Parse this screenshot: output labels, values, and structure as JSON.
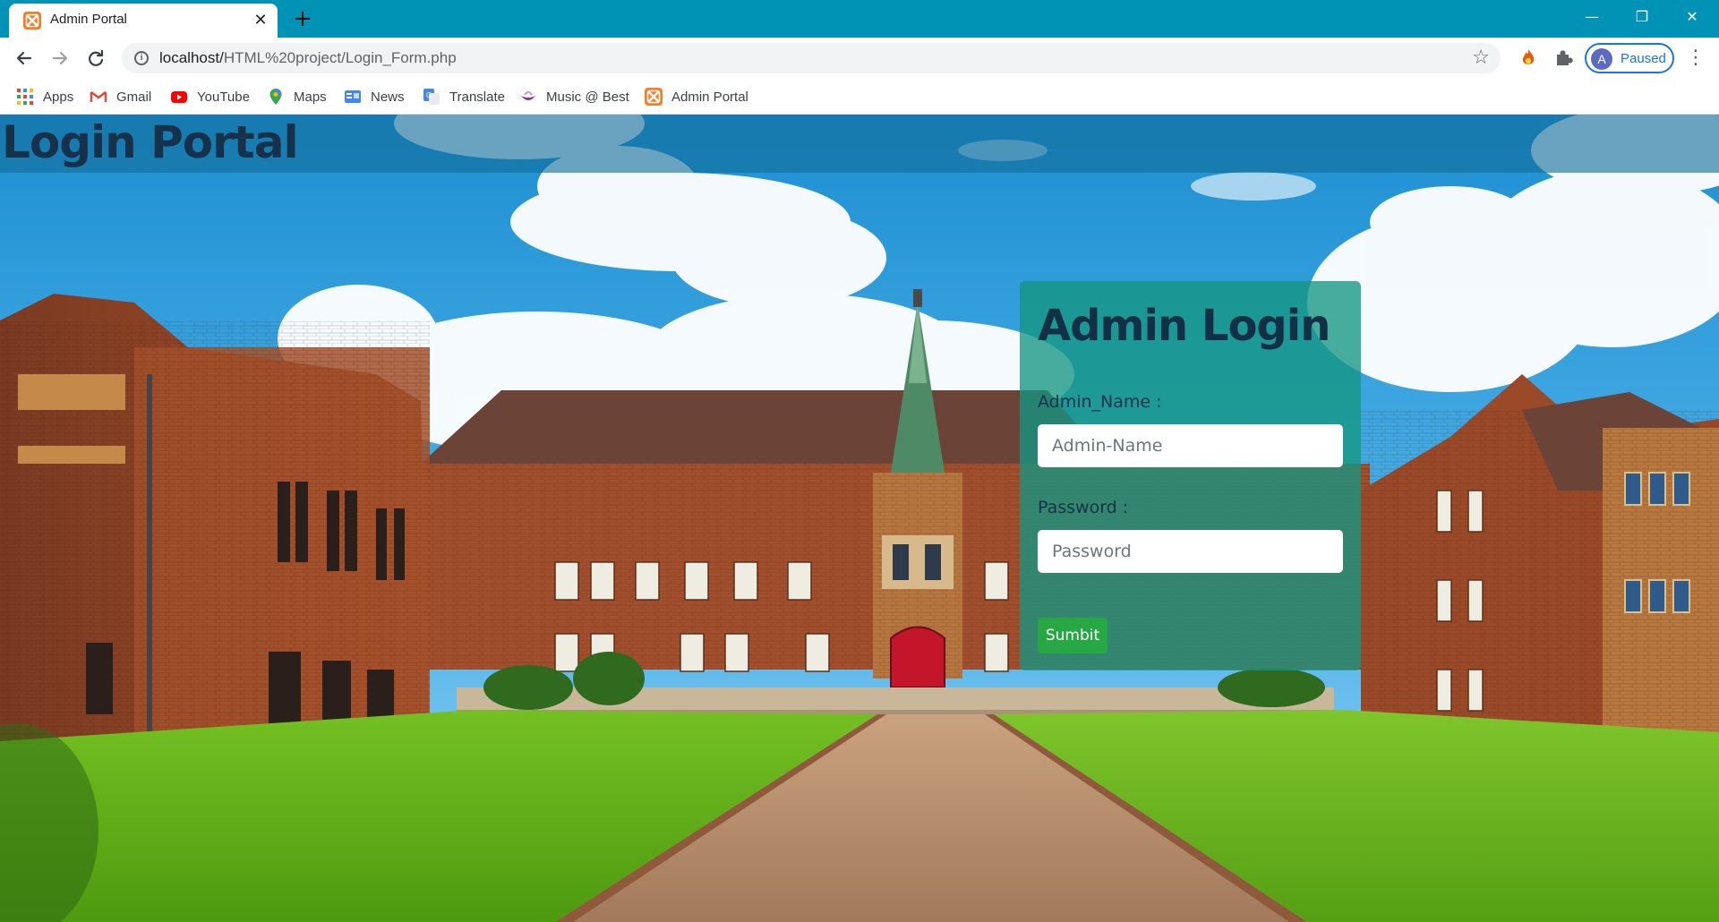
{
  "browser": {
    "tab": {
      "title": "Admin Portal",
      "close_glyph": "✕"
    },
    "new_tab_glyph": "+",
    "window_controls": {
      "minimize": "—",
      "restore": "❐",
      "close": "✕"
    },
    "address_bar": {
      "host": "localhost/",
      "path": "HTML%20project/Login_Form.php"
    },
    "profile": {
      "initial": "A",
      "status": "Paused"
    }
  },
  "bookmarks": [
    {
      "label": "Apps",
      "icon": "apps-grid-icon"
    },
    {
      "label": "Gmail",
      "icon": "gmail-icon"
    },
    {
      "label": "YouTube",
      "icon": "youtube-icon"
    },
    {
      "label": "Maps",
      "icon": "maps-pin-icon"
    },
    {
      "label": "News",
      "icon": "google-news-icon"
    },
    {
      "label": "Translate",
      "icon": "google-translate-icon"
    },
    {
      "label": "Music @ Best",
      "icon": "music-icon"
    },
    {
      "label": "Admin Portal",
      "icon": "xampp-icon"
    }
  ],
  "page": {
    "header_title": "Login Portal",
    "login": {
      "heading": "Admin Login",
      "name_label": "Admin_Name :",
      "name_placeholder": "Admin-Name",
      "password_label": "Password :",
      "password_placeholder": "Password",
      "submit_label": "Sumbit"
    }
  },
  "colors": {
    "chrome_frame": "#0193b6",
    "header_bar": "#146e9b",
    "card": "#14968c",
    "submit": "#28a745"
  }
}
